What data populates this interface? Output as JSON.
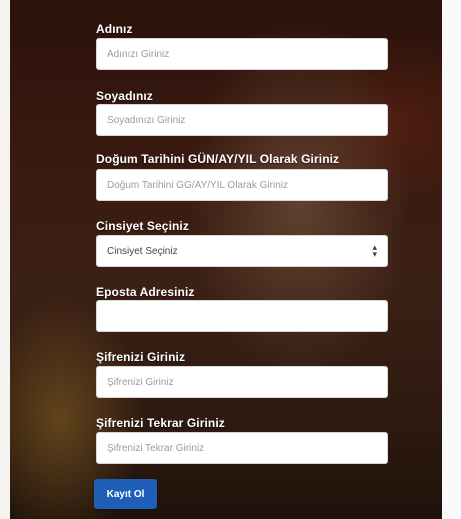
{
  "colors": {
    "button_bg": "#1f5fb8",
    "label_text": "#ffffff",
    "placeholder_text": "#9c9c9c"
  },
  "form": {
    "name_label": "Adınız",
    "name_placeholder": "Adınızı Giriniz",
    "surname_label": "Soyadınız",
    "surname_placeholder": "Soyadınızı Giriniz",
    "birthdate_label": "Doğum Tarihini GÜN/AY/YIL Olarak Giriniz",
    "birthdate_placeholder": "Doğum Tarihini GG/AY/YIL Olarak Giriniz",
    "gender_label": "Cinsiyet Seçiniz",
    "gender_selected": "Cinsiyet Seçiniz",
    "gender_arrow_icon": "updown-chevron-icon",
    "email_label": "Eposta Adresiniz",
    "email_value": "",
    "password_label": "Şifrenizi Giriniz",
    "password_placeholder": "Şifrenizi Giriniz",
    "password_repeat_label": "Şifrenizi Tekrar Giriniz",
    "password_repeat_placeholder": "Şifrenizi Tekrar Giriniz",
    "submit_label": "Kayıt Ol"
  }
}
